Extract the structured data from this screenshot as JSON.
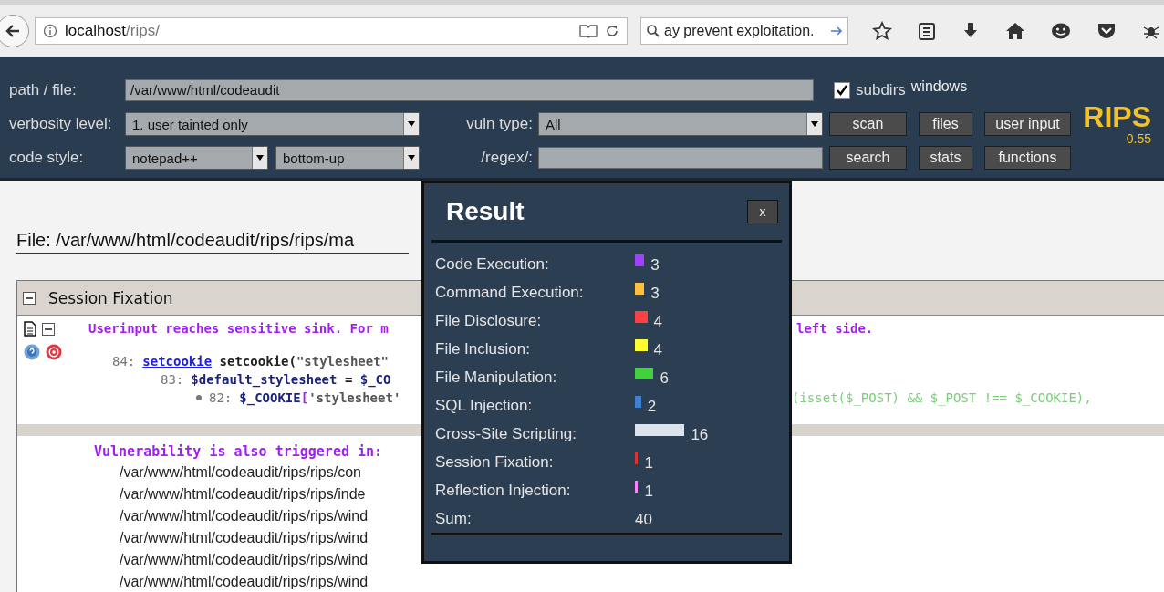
{
  "browser": {
    "url_host": "localhost",
    "url_path": "/rips/",
    "search": "ay prevent exploitation."
  },
  "toolbar": {
    "path_label": "path / file:",
    "path_value": "/var/www/html/codeaudit",
    "subdirs": {
      "label": "subdirs",
      "checked": true
    },
    "windows_label": "windows",
    "verbosity_label": "verbosity level:",
    "verbosity_value": "1. user tainted only",
    "vuln_type_label": "vuln type:",
    "vuln_type_value": "All",
    "code_style_label": "code style:",
    "code_style_value": "notepad++",
    "order_value": "bottom-up",
    "regex_label": "/regex/:",
    "buttons": [
      "scan",
      "search",
      "files",
      "stats",
      "user input",
      "functions"
    ]
  },
  "logo": {
    "name": "RIPS",
    "version": "0.55"
  },
  "file_title": "File: /var/www/html/codeaudit/rips/rips/ma",
  "section": {
    "title": "Session Fixation",
    "message_left": "Userinput reaches sensitive sink. For m",
    "message_right": "left side.",
    "trace": [
      {
        "line": "84:",
        "parts": [
          {
            "kind": "link",
            "text": "setcookie"
          },
          {
            "kind": "plain",
            "text": " setcookie("
          },
          {
            "kind": "string",
            "text": "\"stylesheet\""
          }
        ],
        "children": [
          {
            "line": "83:",
            "parts": [
              {
                "kind": "var",
                "text": "$default_stylesheet"
              },
              {
                "kind": "plain",
                "text": " = "
              },
              {
                "kind": "var",
                "text": "$_CO"
              }
            ],
            "children": [
              {
                "line": "82:",
                "parts": [
                  {
                    "kind": "var",
                    "text": "$_COOKIE"
                  },
                  {
                    "kind": "punct",
                    "text": "["
                  },
                  {
                    "kind": "string",
                    "text": "'stylesheet'"
                  }
                ],
                "tail": "(isset($_POST) && $_POST !== $_COOKIE),"
              }
            ]
          }
        ]
      }
    ],
    "also_label": "Vulnerability is also triggered in:",
    "files": [
      "/var/www/html/codeaudit/rips/rips/con",
      "/var/www/html/codeaudit/rips/rips/inde",
      "/var/www/html/codeaudit/rips/rips/wind",
      "/var/www/html/codeaudit/rips/rips/wind",
      "/var/www/html/codeaudit/rips/rips/wind",
      "/var/www/html/codeaudit/rips/rips/wind"
    ]
  },
  "result": {
    "title": "Result",
    "close": "x",
    "stats": [
      {
        "label": "Code Execution:",
        "color": "#a040ff",
        "count": "3"
      },
      {
        "label": "Command Execution:",
        "color": "#ffc040",
        "count": "3"
      },
      {
        "label": "File Disclosure:",
        "color": "#ff4040",
        "count": "4"
      },
      {
        "label": "File Inclusion:",
        "color": "#ffff30",
        "count": "4"
      },
      {
        "label": "File Manipulation:",
        "color": "#40d040",
        "count": "6"
      },
      {
        "label": "SQL Injection:",
        "color": "#4080d0",
        "count": "2"
      },
      {
        "label": "Cross-Site Scripting:",
        "color": "#dde3ea",
        "count": "16"
      },
      {
        "label": "Session Fixation:",
        "color": "#e03030",
        "count": "1"
      },
      {
        "label": "Reflection Injection:",
        "color": "#ff80ff",
        "count": "1"
      }
    ],
    "sum": {
      "label": "Sum:",
      "value": "40"
    }
  }
}
